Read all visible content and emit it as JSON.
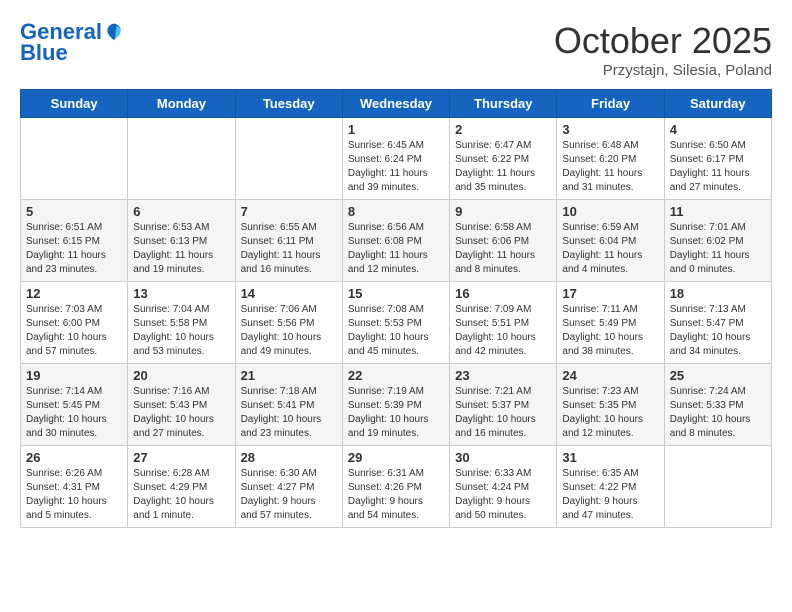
{
  "header": {
    "logo_line1": "General",
    "logo_line2": "Blue",
    "month": "October 2025",
    "location": "Przystajn, Silesia, Poland"
  },
  "weekdays": [
    "Sunday",
    "Monday",
    "Tuesday",
    "Wednesday",
    "Thursday",
    "Friday",
    "Saturday"
  ],
  "weeks": [
    [
      {
        "day": "",
        "info": ""
      },
      {
        "day": "",
        "info": ""
      },
      {
        "day": "",
        "info": ""
      },
      {
        "day": "1",
        "info": "Sunrise: 6:45 AM\nSunset: 6:24 PM\nDaylight: 11 hours\nand 39 minutes."
      },
      {
        "day": "2",
        "info": "Sunrise: 6:47 AM\nSunset: 6:22 PM\nDaylight: 11 hours\nand 35 minutes."
      },
      {
        "day": "3",
        "info": "Sunrise: 6:48 AM\nSunset: 6:20 PM\nDaylight: 11 hours\nand 31 minutes."
      },
      {
        "day": "4",
        "info": "Sunrise: 6:50 AM\nSunset: 6:17 PM\nDaylight: 11 hours\nand 27 minutes."
      }
    ],
    [
      {
        "day": "5",
        "info": "Sunrise: 6:51 AM\nSunset: 6:15 PM\nDaylight: 11 hours\nand 23 minutes."
      },
      {
        "day": "6",
        "info": "Sunrise: 6:53 AM\nSunset: 6:13 PM\nDaylight: 11 hours\nand 19 minutes."
      },
      {
        "day": "7",
        "info": "Sunrise: 6:55 AM\nSunset: 6:11 PM\nDaylight: 11 hours\nand 16 minutes."
      },
      {
        "day": "8",
        "info": "Sunrise: 6:56 AM\nSunset: 6:08 PM\nDaylight: 11 hours\nand 12 minutes."
      },
      {
        "day": "9",
        "info": "Sunrise: 6:58 AM\nSunset: 6:06 PM\nDaylight: 11 hours\nand 8 minutes."
      },
      {
        "day": "10",
        "info": "Sunrise: 6:59 AM\nSunset: 6:04 PM\nDaylight: 11 hours\nand 4 minutes."
      },
      {
        "day": "11",
        "info": "Sunrise: 7:01 AM\nSunset: 6:02 PM\nDaylight: 11 hours\nand 0 minutes."
      }
    ],
    [
      {
        "day": "12",
        "info": "Sunrise: 7:03 AM\nSunset: 6:00 PM\nDaylight: 10 hours\nand 57 minutes."
      },
      {
        "day": "13",
        "info": "Sunrise: 7:04 AM\nSunset: 5:58 PM\nDaylight: 10 hours\nand 53 minutes."
      },
      {
        "day": "14",
        "info": "Sunrise: 7:06 AM\nSunset: 5:56 PM\nDaylight: 10 hours\nand 49 minutes."
      },
      {
        "day": "15",
        "info": "Sunrise: 7:08 AM\nSunset: 5:53 PM\nDaylight: 10 hours\nand 45 minutes."
      },
      {
        "day": "16",
        "info": "Sunrise: 7:09 AM\nSunset: 5:51 PM\nDaylight: 10 hours\nand 42 minutes."
      },
      {
        "day": "17",
        "info": "Sunrise: 7:11 AM\nSunset: 5:49 PM\nDaylight: 10 hours\nand 38 minutes."
      },
      {
        "day": "18",
        "info": "Sunrise: 7:13 AM\nSunset: 5:47 PM\nDaylight: 10 hours\nand 34 minutes."
      }
    ],
    [
      {
        "day": "19",
        "info": "Sunrise: 7:14 AM\nSunset: 5:45 PM\nDaylight: 10 hours\nand 30 minutes."
      },
      {
        "day": "20",
        "info": "Sunrise: 7:16 AM\nSunset: 5:43 PM\nDaylight: 10 hours\nand 27 minutes."
      },
      {
        "day": "21",
        "info": "Sunrise: 7:18 AM\nSunset: 5:41 PM\nDaylight: 10 hours\nand 23 minutes."
      },
      {
        "day": "22",
        "info": "Sunrise: 7:19 AM\nSunset: 5:39 PM\nDaylight: 10 hours\nand 19 minutes."
      },
      {
        "day": "23",
        "info": "Sunrise: 7:21 AM\nSunset: 5:37 PM\nDaylight: 10 hours\nand 16 minutes."
      },
      {
        "day": "24",
        "info": "Sunrise: 7:23 AM\nSunset: 5:35 PM\nDaylight: 10 hours\nand 12 minutes."
      },
      {
        "day": "25",
        "info": "Sunrise: 7:24 AM\nSunset: 5:33 PM\nDaylight: 10 hours\nand 8 minutes."
      }
    ],
    [
      {
        "day": "26",
        "info": "Sunrise: 6:26 AM\nSunset: 4:31 PM\nDaylight: 10 hours\nand 5 minutes."
      },
      {
        "day": "27",
        "info": "Sunrise: 6:28 AM\nSunset: 4:29 PM\nDaylight: 10 hours\nand 1 minute."
      },
      {
        "day": "28",
        "info": "Sunrise: 6:30 AM\nSunset: 4:27 PM\nDaylight: 9 hours\nand 57 minutes."
      },
      {
        "day": "29",
        "info": "Sunrise: 6:31 AM\nSunset: 4:26 PM\nDaylight: 9 hours\nand 54 minutes."
      },
      {
        "day": "30",
        "info": "Sunrise: 6:33 AM\nSunset: 4:24 PM\nDaylight: 9 hours\nand 50 minutes."
      },
      {
        "day": "31",
        "info": "Sunrise: 6:35 AM\nSunset: 4:22 PM\nDaylight: 9 hours\nand 47 minutes."
      },
      {
        "day": "",
        "info": ""
      }
    ]
  ]
}
